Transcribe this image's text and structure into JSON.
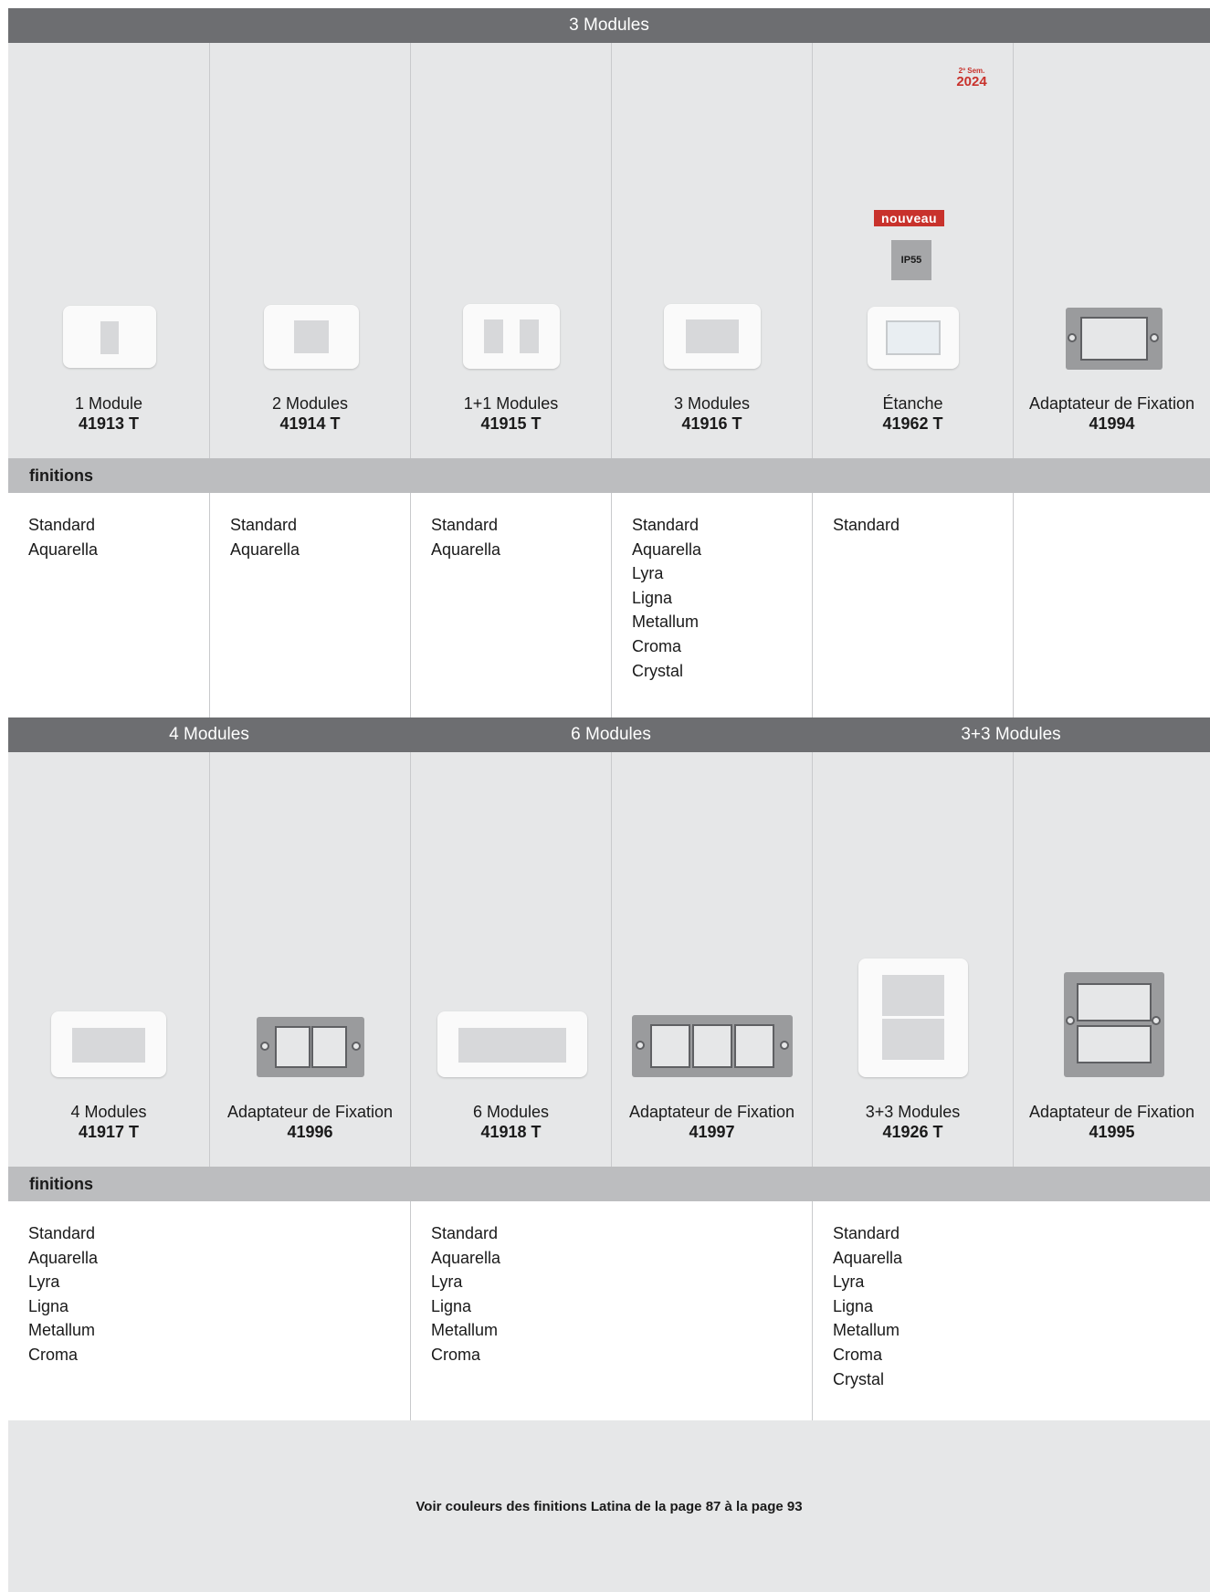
{
  "section1": {
    "header": "3 Modules",
    "products": [
      {
        "name": "1 Module",
        "code": "41913 T"
      },
      {
        "name": "2 Modules",
        "code": "41914 T"
      },
      {
        "name": "1+1 Modules",
        "code": "41915 T"
      },
      {
        "name": "3 Modules",
        "code": "41916 T"
      },
      {
        "name": "Étanche",
        "code": "41962 T"
      },
      {
        "name": "Adaptateur de Fixation",
        "code": "41994"
      }
    ],
    "badges": {
      "sem_top": "2º Sem.",
      "sem_year": "2024",
      "new": "nouveau",
      "ip": "IP55"
    },
    "finishes_label": "finitions",
    "finishes": [
      [
        "Standard",
        "Aquarella"
      ],
      [
        "Standard",
        "Aquarella"
      ],
      [
        "Standard",
        "Aquarella"
      ],
      [
        "Standard",
        "Aquarella",
        "Lyra",
        "Ligna",
        "Metallum",
        "Croma",
        "Crystal"
      ],
      [
        "Standard"
      ],
      []
    ]
  },
  "section2": {
    "headers": [
      "4 Modules",
      "6 Modules",
      "3+3 Modules"
    ],
    "products": [
      {
        "name": "4 Modules",
        "code": "41917 T"
      },
      {
        "name": "Adaptateur de Fixation",
        "code": "41996"
      },
      {
        "name": "6 Modules",
        "code": "41918 T"
      },
      {
        "name": "Adaptateur de Fixation",
        "code": "41997"
      },
      {
        "name": "3+3 Modules",
        "code": "41926 T"
      },
      {
        "name": "Adaptateur de Fixation",
        "code": "41995"
      }
    ],
    "finishes_label": "finitions",
    "finishes": [
      [
        "Standard",
        "Aquarella",
        "Lyra",
        "Ligna",
        "Metallum",
        "Croma"
      ],
      [
        "Standard",
        "Aquarella",
        "Lyra",
        "Ligna",
        "Metallum",
        "Croma"
      ],
      [
        "Standard",
        "Aquarella",
        "Lyra",
        "Ligna",
        "Metallum",
        "Croma",
        "Crystal"
      ]
    ]
  },
  "footer": {
    "note": "Voir couleurs des finitions Latina de la page 87 à la page 93"
  },
  "colors": {
    "header_bg": "#6d6e71",
    "product_bg": "#e6e7e8",
    "finish_bar_bg": "#bcbdbf",
    "badge_red": "#c8322c"
  }
}
